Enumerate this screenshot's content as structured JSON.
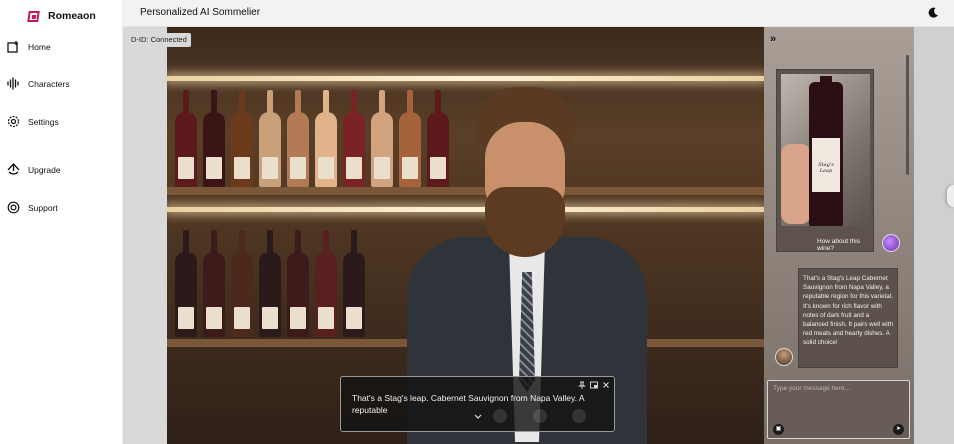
{
  "brand": {
    "name": "Romeaon"
  },
  "sidebar": {
    "items": [
      {
        "label": "Home",
        "icon": "new-chat-icon"
      },
      {
        "label": "Characters",
        "icon": "soundwave-icon"
      },
      {
        "label": "Settings",
        "icon": "gear-icon"
      },
      {
        "label": "Upgrade",
        "icon": "upgrade-icon"
      },
      {
        "label": "Support",
        "icon": "lifebuoy-icon"
      }
    ]
  },
  "header": {
    "title": "Personalized AI Sommelier",
    "theme_icon": "moon-icon"
  },
  "video": {
    "status": "D-ID: Connected",
    "caption": "That's a Stag's leap. Cabernet Sauvignon from Napa Valley. A reputable"
  },
  "chat": {
    "user_image_caption": "How about this wine?",
    "wine_label_text": "Stag's Leap",
    "bot_reply": "That's a Stag's Leap Cabernet Sauvignon from Napa Valley, a reputable region for this varietal. It's known for rich flavor with notes of dark fruit and a balanced finish. It pairs well with red meats and hearty dishes. A solid choice!",
    "input_placeholder": "Type your message here..."
  },
  "colors": {
    "accent": "#c2185b",
    "header_bg": "#f2f2f2"
  }
}
